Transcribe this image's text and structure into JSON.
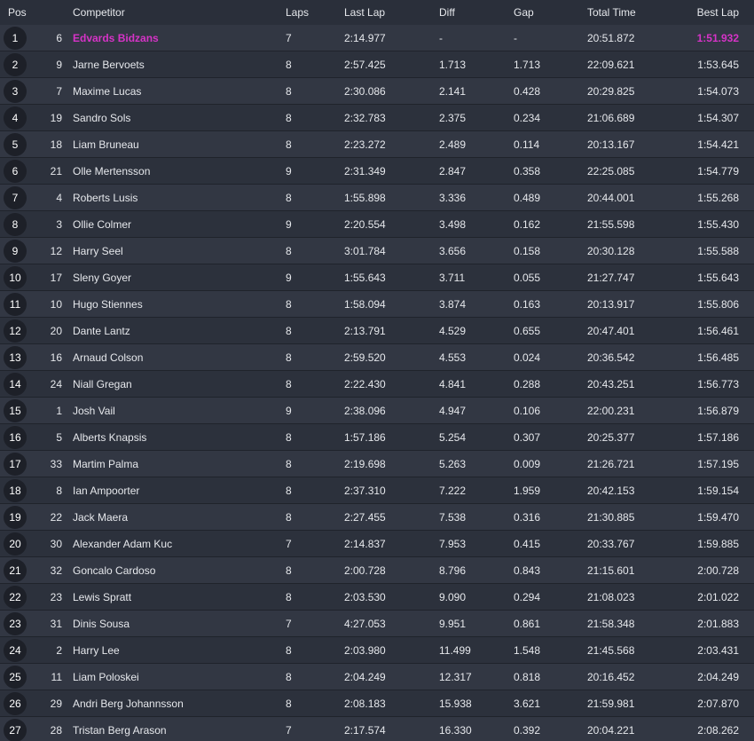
{
  "colors": {
    "background": "#2a2f3a",
    "row_odd": "#323743",
    "row_even": "#2c313c",
    "highlight": "#d633c7"
  },
  "columns": {
    "pos": "Pos",
    "competitor": "Competitor",
    "laps": "Laps",
    "last_lap": "Last Lap",
    "diff": "Diff",
    "gap": "Gap",
    "total_time": "Total Time",
    "best_lap": "Best Lap"
  },
  "rows": [
    {
      "pos": "1",
      "num": "6",
      "name": "Edvards Bidzans",
      "laps": "7",
      "last": "2:14.977",
      "diff": "-",
      "gap": "-",
      "total": "20:51.872",
      "best": "1:51.932",
      "highlight": true
    },
    {
      "pos": "2",
      "num": "9",
      "name": "Jarne Bervoets",
      "laps": "8",
      "last": "2:57.425",
      "diff": "1.713",
      "gap": "1.713",
      "total": "22:09.621",
      "best": "1:53.645"
    },
    {
      "pos": "3",
      "num": "7",
      "name": "Maxime Lucas",
      "laps": "8",
      "last": "2:30.086",
      "diff": "2.141",
      "gap": "0.428",
      "total": "20:29.825",
      "best": "1:54.073"
    },
    {
      "pos": "4",
      "num": "19",
      "name": "Sandro Sols",
      "laps": "8",
      "last": "2:32.783",
      "diff": "2.375",
      "gap": "0.234",
      "total": "21:06.689",
      "best": "1:54.307"
    },
    {
      "pos": "5",
      "num": "18",
      "name": "Liam Bruneau",
      "laps": "8",
      "last": "2:23.272",
      "diff": "2.489",
      "gap": "0.114",
      "total": "20:13.167",
      "best": "1:54.421"
    },
    {
      "pos": "6",
      "num": "21",
      "name": "Olle Mertensson",
      "laps": "9",
      "last": "2:31.349",
      "diff": "2.847",
      "gap": "0.358",
      "total": "22:25.085",
      "best": "1:54.779"
    },
    {
      "pos": "7",
      "num": "4",
      "name": "Roberts Lusis",
      "laps": "8",
      "last": "1:55.898",
      "diff": "3.336",
      "gap": "0.489",
      "total": "20:44.001",
      "best": "1:55.268"
    },
    {
      "pos": "8",
      "num": "3",
      "name": "Ollie Colmer",
      "laps": "9",
      "last": "2:20.554",
      "diff": "3.498",
      "gap": "0.162",
      "total": "21:55.598",
      "best": "1:55.430"
    },
    {
      "pos": "9",
      "num": "12",
      "name": "Harry Seel",
      "laps": "8",
      "last": "3:01.784",
      "diff": "3.656",
      "gap": "0.158",
      "total": "20:30.128",
      "best": "1:55.588"
    },
    {
      "pos": "10",
      "num": "17",
      "name": "Sleny Goyer",
      "laps": "9",
      "last": "1:55.643",
      "diff": "3.711",
      "gap": "0.055",
      "total": "21:27.747",
      "best": "1:55.643"
    },
    {
      "pos": "11",
      "num": "10",
      "name": "Hugo Stiennes",
      "laps": "8",
      "last": "1:58.094",
      "diff": "3.874",
      "gap": "0.163",
      "total": "20:13.917",
      "best": "1:55.806"
    },
    {
      "pos": "12",
      "num": "20",
      "name": "Dante Lantz",
      "laps": "8",
      "last": "2:13.791",
      "diff": "4.529",
      "gap": "0.655",
      "total": "20:47.401",
      "best": "1:56.461"
    },
    {
      "pos": "13",
      "num": "16",
      "name": "Arnaud Colson",
      "laps": "8",
      "last": "2:59.520",
      "diff": "4.553",
      "gap": "0.024",
      "total": "20:36.542",
      "best": "1:56.485"
    },
    {
      "pos": "14",
      "num": "24",
      "name": "Niall Gregan",
      "laps": "8",
      "last": "2:22.430",
      "diff": "4.841",
      "gap": "0.288",
      "total": "20:43.251",
      "best": "1:56.773"
    },
    {
      "pos": "15",
      "num": "1",
      "name": "Josh Vail",
      "laps": "9",
      "last": "2:38.096",
      "diff": "4.947",
      "gap": "0.106",
      "total": "22:00.231",
      "best": "1:56.879"
    },
    {
      "pos": "16",
      "num": "5",
      "name": "Alberts Knapsis",
      "laps": "8",
      "last": "1:57.186",
      "diff": "5.254",
      "gap": "0.307",
      "total": "20:25.377",
      "best": "1:57.186"
    },
    {
      "pos": "17",
      "num": "33",
      "name": "Martim Palma",
      "laps": "8",
      "last": "2:19.698",
      "diff": "5.263",
      "gap": "0.009",
      "total": "21:26.721",
      "best": "1:57.195"
    },
    {
      "pos": "18",
      "num": "8",
      "name": "Ian Ampoorter",
      "laps": "8",
      "last": "2:37.310",
      "diff": "7.222",
      "gap": "1.959",
      "total": "20:42.153",
      "best": "1:59.154"
    },
    {
      "pos": "19",
      "num": "22",
      "name": "Jack Maera",
      "laps": "8",
      "last": "2:27.455",
      "diff": "7.538",
      "gap": "0.316",
      "total": "21:30.885",
      "best": "1:59.470"
    },
    {
      "pos": "20",
      "num": "30",
      "name": "Alexander Adam Kuc",
      "laps": "7",
      "last": "2:14.837",
      "diff": "7.953",
      "gap": "0.415",
      "total": "20:33.767",
      "best": "1:59.885"
    },
    {
      "pos": "21",
      "num": "32",
      "name": "Goncalo Cardoso",
      "laps": "8",
      "last": "2:00.728",
      "diff": "8.796",
      "gap": "0.843",
      "total": "21:15.601",
      "best": "2:00.728"
    },
    {
      "pos": "22",
      "num": "23",
      "name": "Lewis Spratt",
      "laps": "8",
      "last": "2:03.530",
      "diff": "9.090",
      "gap": "0.294",
      "total": "21:08.023",
      "best": "2:01.022"
    },
    {
      "pos": "23",
      "num": "31",
      "name": "Dinis Sousa",
      "laps": "7",
      "last": "4:27.053",
      "diff": "9.951",
      "gap": "0.861",
      "total": "21:58.348",
      "best": "2:01.883"
    },
    {
      "pos": "24",
      "num": "2",
      "name": "Harry Lee",
      "laps": "8",
      "last": "2:03.980",
      "diff": "11.499",
      "gap": "1.548",
      "total": "21:45.568",
      "best": "2:03.431"
    },
    {
      "pos": "25",
      "num": "11",
      "name": "Liam Poloskei",
      "laps": "8",
      "last": "2:04.249",
      "diff": "12.317",
      "gap": "0.818",
      "total": "20:16.452",
      "best": "2:04.249"
    },
    {
      "pos": "26",
      "num": "29",
      "name": "Andri Berg Johannsson",
      "laps": "8",
      "last": "2:08.183",
      "diff": "15.938",
      "gap": "3.621",
      "total": "21:59.981",
      "best": "2:07.870"
    },
    {
      "pos": "27",
      "num": "28",
      "name": "Tristan Berg Arason",
      "laps": "7",
      "last": "2:17.574",
      "diff": "16.330",
      "gap": "0.392",
      "total": "20:04.221",
      "best": "2:08.262"
    }
  ]
}
